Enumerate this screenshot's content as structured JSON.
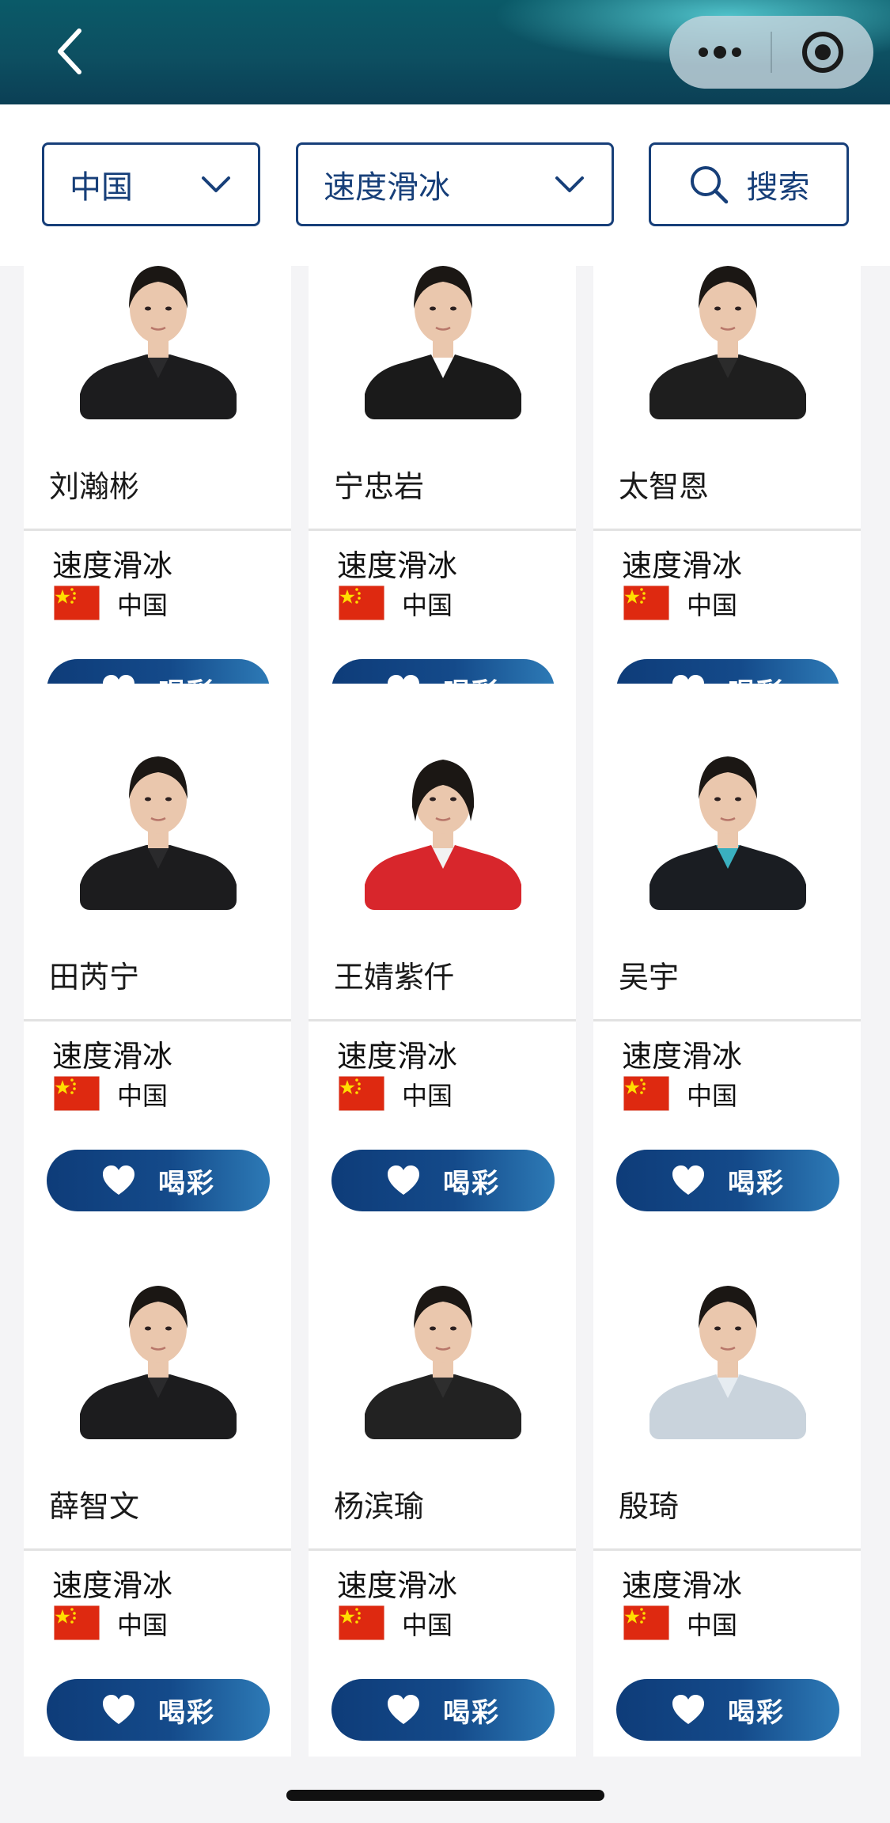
{
  "nav": {
    "back_icon": "chevron-left-icon",
    "capsule_icons": [
      "more-dots-icon",
      "target-circle-icon"
    ]
  },
  "filters": {
    "country_value": "中国",
    "sport_value": "速度滑冰",
    "search_label": "搜索"
  },
  "cards": [
    {
      "name": "刘瀚彬",
      "sport": "速度滑冰",
      "country": "中国",
      "cheer_label": "喝彩",
      "attire": "black jacket"
    },
    {
      "name": "宁忠岩",
      "sport": "速度滑冰",
      "country": "中国",
      "cheer_label": "喝彩",
      "attire": "black suit"
    },
    {
      "name": "太智恩",
      "sport": "速度滑冰",
      "country": "中国",
      "cheer_label": "喝彩",
      "attire": "black team shirt"
    },
    {
      "name": "田芮宁",
      "sport": "速度滑冰",
      "country": "中国",
      "cheer_label": "喝彩",
      "attire": "black jacket"
    },
    {
      "name": "王婧紫仟",
      "sport": "速度滑冰",
      "country": "中国",
      "cheer_label": "喝彩",
      "attire": "red jacket"
    },
    {
      "name": "吴宇",
      "sport": "速度滑冰",
      "country": "中国",
      "cheer_label": "喝彩",
      "attire": "black team jacket"
    },
    {
      "name": "薛智文",
      "sport": "速度滑冰",
      "country": "中国",
      "cheer_label": "喝彩",
      "attire": "black jacket"
    },
    {
      "name": "杨滨瑜",
      "sport": "速度滑冰",
      "country": "中国",
      "cheer_label": "喝彩",
      "attire": "black shirt"
    },
    {
      "name": "殷琦",
      "sport": "速度滑冰",
      "country": "中国",
      "cheer_label": "喝彩",
      "attire": "striped shirt"
    }
  ],
  "colors": {
    "accent": "#173f79",
    "cheer_gradient_start": "#0e3c79",
    "cheer_gradient_end": "#2d7ab6",
    "flag_red": "#de2910",
    "flag_star": "#ffde00"
  }
}
